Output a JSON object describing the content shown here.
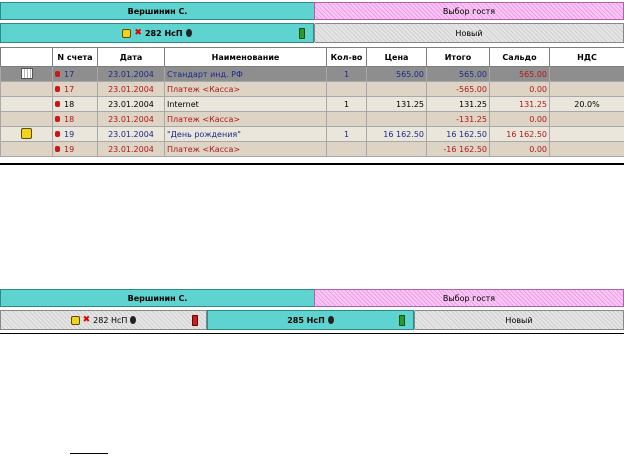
{
  "top": {
    "guest_name": "Вершинин С.",
    "select_guest": "Выбор гостя",
    "acct_active_label": "282 НсП",
    "acct_new_label": "Новый"
  },
  "table": {
    "columns": [
      "",
      "N счета",
      "Дата",
      "Наименование",
      "Кол-во",
      "Цена",
      "Итого",
      "Сальдо",
      "НДС"
    ],
    "rows": [
      {
        "icon": "grid",
        "num": "17",
        "date": "23.01.2004",
        "name": "Стандарт инд. РФ",
        "qty": "1",
        "price": "565.00",
        "total": "565.00",
        "saldo": "565.00",
        "vat": ""
      },
      {
        "icon": "",
        "num": "17",
        "date": "23.01.2004",
        "name": "Платеж <Касса>",
        "qty": "",
        "price": "",
        "total": "-565.00",
        "saldo": "0.00",
        "vat": ""
      },
      {
        "icon": "",
        "num": "18",
        "date": "23.01.2004",
        "name": "Internet",
        "qty": "1",
        "price": "131.25",
        "total": "131.25",
        "saldo": "131.25",
        "vat": "20.0%"
      },
      {
        "icon": "",
        "num": "18",
        "date": "23.01.2004",
        "name": "Платеж <Касса>",
        "qty": "",
        "price": "",
        "total": "-131.25",
        "saldo": "0.00",
        "vat": ""
      },
      {
        "icon": "guest",
        "num": "19",
        "date": "23.01.2004",
        "name": "\"День рождения\"",
        "qty": "1",
        "price": "16 162.50",
        "total": "16 162.50",
        "saldo": "16 162.50",
        "vat": ""
      },
      {
        "icon": "",
        "num": "19",
        "date": "23.01.2004",
        "name": "Платеж <Касса>",
        "qty": "",
        "price": "",
        "total": "-16 162.50",
        "saldo": "0.00",
        "vat": ""
      }
    ]
  },
  "bottom": {
    "guest_name": "Вершинин С.",
    "select_guest": "Выбор гостя",
    "acct_282_label": "282 НсП",
    "acct_285_label": "285 НсП",
    "acct_new_label": "Новый"
  }
}
